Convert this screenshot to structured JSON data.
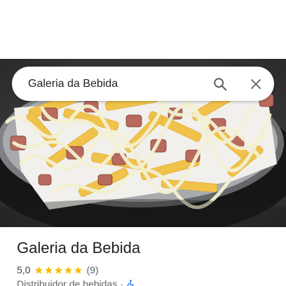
{
  "search": {
    "query": "Galeria da Bebida",
    "search_icon": "search-icon",
    "close_icon": "close-icon"
  },
  "photo": {
    "subject": "photo"
  },
  "place": {
    "name": "Galeria da Bebida",
    "rating": "5,0",
    "stars": 5,
    "review_count": "(9)",
    "category": "Distribuidor de bebidas",
    "separator": "·",
    "accessibility_icon": "wheelchair-icon"
  },
  "colors": {
    "star": "#fbbc04",
    "text_primary": "#202124",
    "text_secondary": "#5f6368",
    "accessibility": "#1a73e8"
  }
}
